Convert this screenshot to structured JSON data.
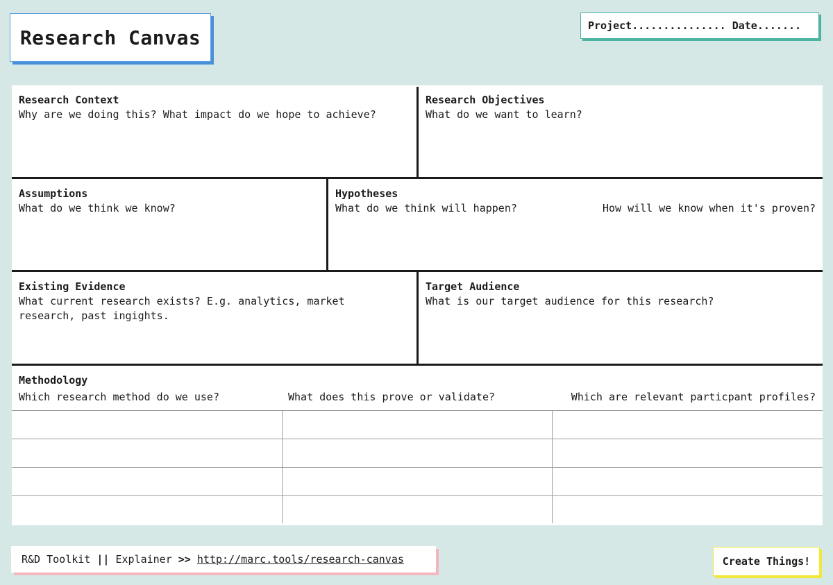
{
  "header": {
    "title": "Research Canvas",
    "project_label": "Project............... Date......."
  },
  "sections": {
    "context": {
      "title": "Research Context",
      "prompt": "Why are we doing this? What impact do we hope to achieve?"
    },
    "objectives": {
      "title": "Research Objectives",
      "prompt": "What do we want to learn?"
    },
    "assumptions": {
      "title": "Assumptions",
      "prompt": "What do we think we know?"
    },
    "hypotheses": {
      "title": "Hypotheses",
      "prompt": "What do we think will happen?",
      "prompt2": "How will we know when it's proven?"
    },
    "evidence": {
      "title": "Existing Evidence",
      "prompt": "What current research exists? E.g. analytics, market research, past ingights."
    },
    "audience": {
      "title": "Target Audience",
      "prompt": "What is our target audience for this research?"
    },
    "methodology": {
      "title": "Methodology",
      "columns": [
        "Which research method do we use?",
        "What does this prove or validate?",
        "Which are relevant particpant profiles?"
      ]
    }
  },
  "footer": {
    "toolkit": "R&D Toolkit",
    "separator": "||",
    "explainer": "Explainer",
    "arrow": ">>",
    "link": "http://marc.tools/research-canvas",
    "cta": "Create Things!"
  }
}
